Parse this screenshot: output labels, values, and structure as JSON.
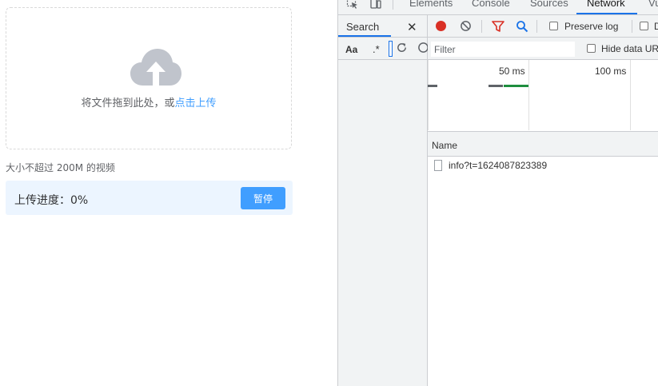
{
  "uploader": {
    "drop_text": "将文件拖到此处，或",
    "drop_link": "点击上传",
    "tip": "大小不超过 200M 的视频",
    "progress_label": "上传进度：0%",
    "progress_percent": 0,
    "pause_label": "暂停",
    "accent_color": "#409eff",
    "icon": "cloud-upload-icon"
  },
  "devtools": {
    "tabs": [
      {
        "label": "Elements",
        "active": false
      },
      {
        "label": "Console",
        "active": false
      },
      {
        "label": "Sources",
        "active": false
      },
      {
        "label": "Network",
        "active": true
      },
      {
        "label": "Vu",
        "active": false
      }
    ],
    "search": {
      "title": "Search",
      "close": "✕",
      "case_option": "Aa",
      "regex_option": ".*"
    },
    "network": {
      "preserve_log_label": "Preserve log",
      "disable_cache_label": "D",
      "filter_placeholder": "Filter",
      "hide_data_urls_label": "Hide data URLs",
      "timeline_labels": [
        "50 ms",
        "100 ms"
      ],
      "column_name": "Name",
      "requests": [
        {
          "name": "info?t=1624087823389"
        }
      ]
    }
  }
}
